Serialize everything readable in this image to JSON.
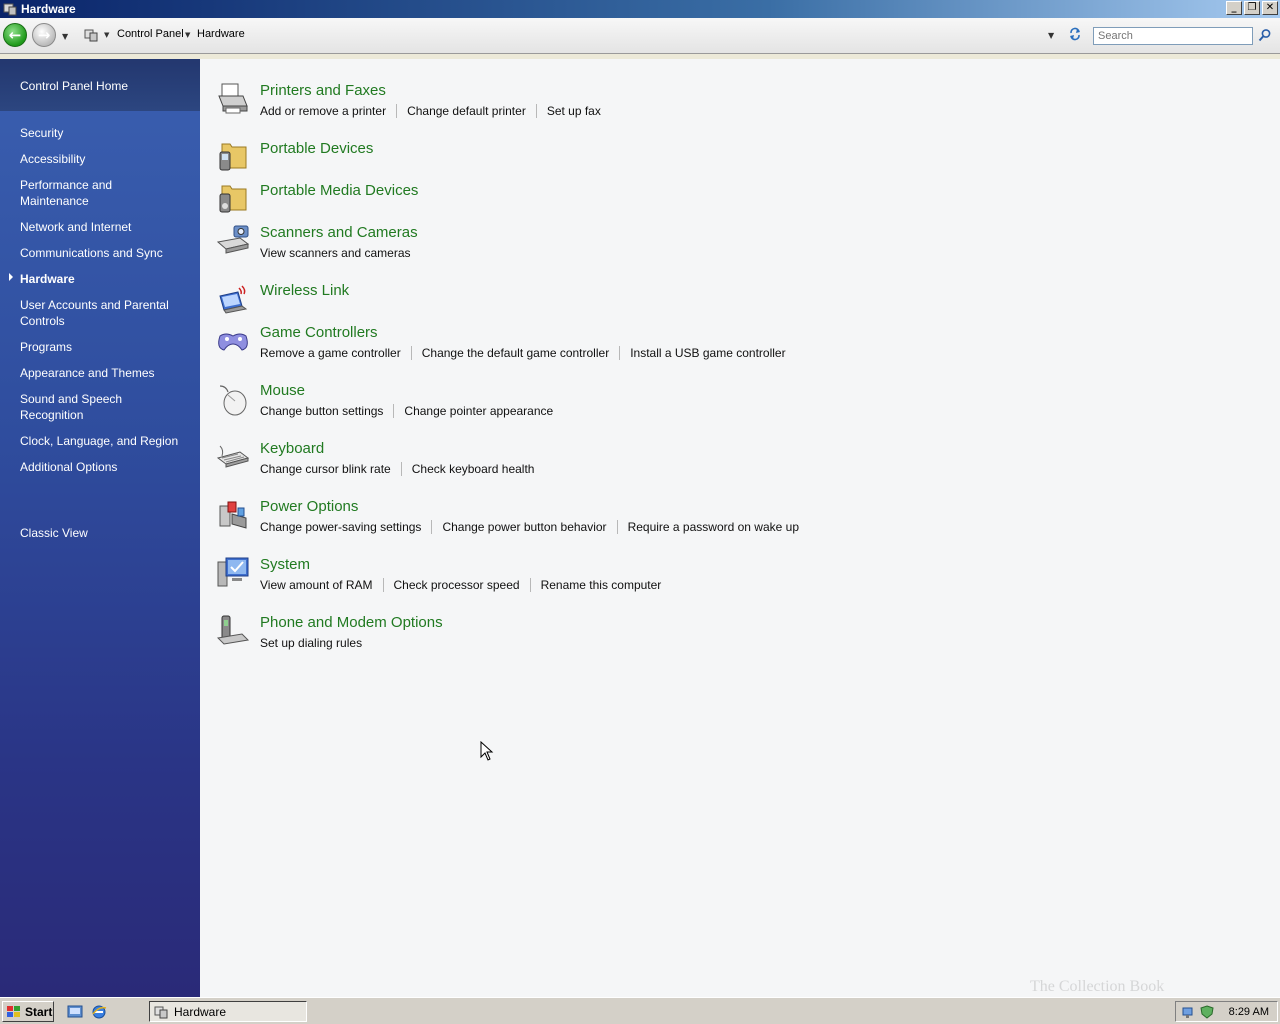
{
  "window": {
    "title": "Hardware"
  },
  "toolbar": {
    "breadcrumb": [
      "Control Panel",
      "Hardware"
    ],
    "search_placeholder": "Search"
  },
  "sidebar": {
    "home": "Control Panel Home",
    "items": [
      {
        "label": "Security"
      },
      {
        "label": "Accessibility"
      },
      {
        "label": "Performance and Maintenance"
      },
      {
        "label": "Network and Internet"
      },
      {
        "label": "Communications and Sync"
      },
      {
        "label": "Hardware",
        "active": true
      },
      {
        "label": "User Accounts and Parental Controls"
      },
      {
        "label": "Programs"
      },
      {
        "label": "Appearance and Themes"
      },
      {
        "label": "Sound and Speech Recognition"
      },
      {
        "label": "Clock, Language, and Region"
      },
      {
        "label": "Additional Options"
      }
    ],
    "classic_view": "Classic View"
  },
  "categories": [
    {
      "title": "Printers and Faxes",
      "icon": "printer-icon",
      "links": [
        "Add or remove a printer",
        "Change default printer",
        "Set up fax"
      ]
    },
    {
      "title": "Portable Devices",
      "icon": "portable-device-icon",
      "links": []
    },
    {
      "title": "Portable Media Devices",
      "icon": "portable-media-icon",
      "links": []
    },
    {
      "title": "Scanners and Cameras",
      "icon": "scanner-icon",
      "links": [
        "View scanners and cameras"
      ]
    },
    {
      "title": "Wireless Link",
      "icon": "wireless-link-icon",
      "links": []
    },
    {
      "title": "Game Controllers",
      "icon": "gamepad-icon",
      "links": [
        "Remove a game controller",
        "Change the default game controller",
        "Install a USB game controller"
      ]
    },
    {
      "title": "Mouse",
      "icon": "mouse-icon",
      "links": [
        "Change button settings",
        "Change pointer appearance"
      ]
    },
    {
      "title": "Keyboard",
      "icon": "keyboard-icon",
      "links": [
        "Change cursor blink rate",
        "Check keyboard health"
      ]
    },
    {
      "title": "Power Options",
      "icon": "power-options-icon",
      "links": [
        "Change power-saving settings",
        "Change power button behavior",
        "Require a password on wake up"
      ]
    },
    {
      "title": "System",
      "icon": "system-icon",
      "links": [
        "View amount of RAM",
        "Check processor speed",
        "Rename this computer"
      ]
    },
    {
      "title": "Phone and Modem Options",
      "icon": "phone-modem-icon",
      "links": [
        "Set up dialing rules"
      ]
    }
  ],
  "taskbar": {
    "start_label": "Start",
    "task_label": "Hardware",
    "clock": "8:29 AM"
  },
  "watermark": "The Collection Book"
}
